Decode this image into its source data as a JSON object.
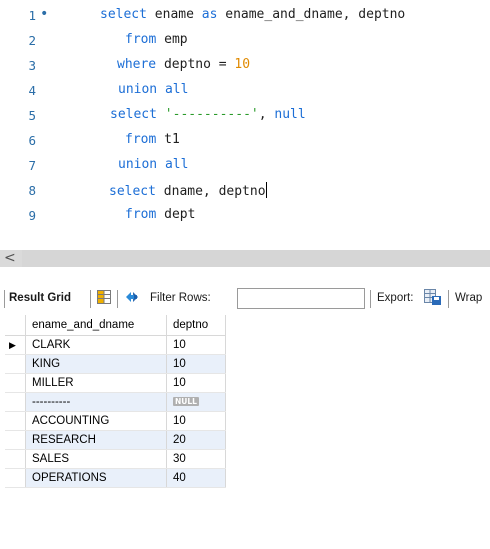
{
  "editor": {
    "lines": [
      {
        "no": "1",
        "marker": "•",
        "segments": [
          {
            "t": "select",
            "c": "kw"
          },
          {
            "t": " ename ",
            "c": ""
          },
          {
            "t": "as",
            "c": "kw"
          },
          {
            "t": " ename_and_dname, deptno",
            "c": ""
          }
        ]
      },
      {
        "no": "2",
        "segments": [
          {
            "t": "from",
            "c": "kw"
          },
          {
            "t": " emp",
            "c": ""
          }
        ]
      },
      {
        "no": "3",
        "segments": [
          {
            "t": "where",
            "c": "kw"
          },
          {
            "t": " deptno = ",
            "c": ""
          },
          {
            "t": "10",
            "c": "num"
          }
        ]
      },
      {
        "no": "4",
        "segments": [
          {
            "t": "union all",
            "c": "kw"
          }
        ]
      },
      {
        "no": "5",
        "segments": [
          {
            "t": "select",
            "c": "kw"
          },
          {
            "t": " ",
            "c": ""
          },
          {
            "t": "'----------'",
            "c": "str"
          },
          {
            "t": ", ",
            "c": ""
          },
          {
            "t": "null",
            "c": "kw"
          }
        ]
      },
      {
        "no": "6",
        "segments": [
          {
            "t": "from",
            "c": "kw"
          },
          {
            "t": " t1",
            "c": ""
          }
        ]
      },
      {
        "no": "7",
        "segments": [
          {
            "t": "union all",
            "c": "kw"
          }
        ]
      },
      {
        "no": "8",
        "segments": [
          {
            "t": "select",
            "c": "kw"
          },
          {
            "t": " dname, deptno",
            "c": ""
          }
        ]
      },
      {
        "no": "9",
        "segments": [
          {
            "t": "from",
            "c": "kw"
          },
          {
            "t": " dept",
            "c": ""
          }
        ]
      }
    ]
  },
  "scrollbar": {
    "left_arrow": "<"
  },
  "toolbar": {
    "result_grid": "Result Grid",
    "filter_rows": "Filter Rows:",
    "filter_value": "",
    "export": "Export:",
    "wrap": "Wrap"
  },
  "grid": {
    "columns": [
      "ename_and_dname",
      "deptno"
    ],
    "null_label": "NULL",
    "current_row_marker": "▶",
    "rows": [
      {
        "name": "CLARK",
        "deptno": "10"
      },
      {
        "name": "KING",
        "deptno": "10"
      },
      {
        "name": "MILLER",
        "deptno": "10"
      },
      {
        "name": "----------",
        "deptno": null
      },
      {
        "name": "ACCOUNTING",
        "deptno": "10"
      },
      {
        "name": "RESEARCH",
        "deptno": "20"
      },
      {
        "name": "SALES",
        "deptno": "30"
      },
      {
        "name": "OPERATIONS",
        "deptno": "40"
      }
    ]
  },
  "colors": {
    "keyword": "#1c6ed6",
    "number": "#e08a00",
    "string": "#2a9a2a",
    "line_number": "#2b6ea8",
    "alt_row": "#e9f0fa"
  }
}
